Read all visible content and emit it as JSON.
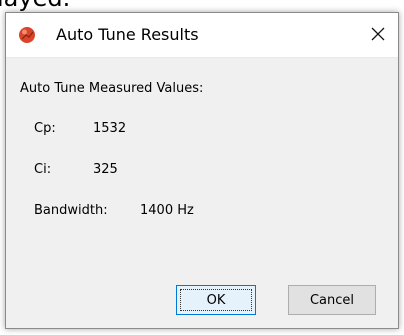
{
  "background_text": "layed.",
  "dialog": {
    "title": "Auto Tune Results",
    "group_label": "Auto Tune Measured Values:",
    "values": [
      {
        "label": "Cp:",
        "value": "1532"
      },
      {
        "label": "Ci:",
        "value": "325"
      },
      {
        "label": "Bandwidth:",
        "value": "1400  Hz"
      }
    ],
    "ok_label": "OK",
    "cancel_label": "Cancel"
  },
  "colors": {
    "icon_red": "#d7452b",
    "accent_blue": "#0078d7"
  },
  "icons": {
    "app": "app-icon",
    "close": "close-icon"
  }
}
